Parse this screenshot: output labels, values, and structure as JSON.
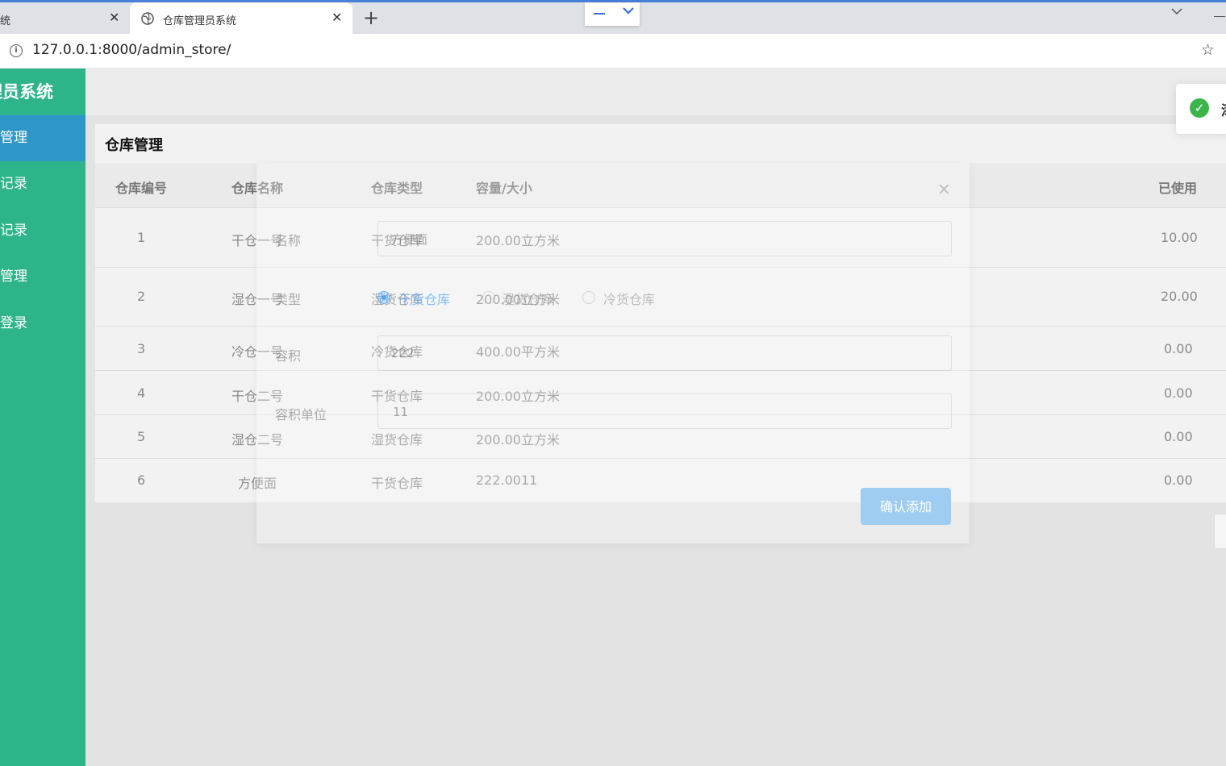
{
  "browser": {
    "tabs": [
      {
        "title": "统",
        "active": false
      },
      {
        "title": "仓库管理员系统",
        "active": true
      }
    ],
    "new_tab": "+",
    "close_glyph": "✕",
    "url": "127.0.0.1:8000/admin_store/",
    "icons": {
      "info": "i",
      "star": "☆",
      "globe": "globe-icon"
    }
  },
  "app": {
    "brand": "理员系统",
    "nav": [
      {
        "label": "库管理",
        "active": true
      },
      {
        "label": "入记录",
        "active": false
      },
      {
        "label": "出记录",
        "active": false
      },
      {
        "label": "户管理",
        "active": false
      },
      {
        "label": "出登录",
        "active": false
      }
    ],
    "accent_color": "#2db48a",
    "active_nav_color": "#2f97c8"
  },
  "card": {
    "title": "仓库管理",
    "headers": [
      "仓库编号",
      "仓库名称",
      "仓库类型",
      "容量/大小",
      "已使用"
    ],
    "rows": [
      {
        "id": "1",
        "name": "干仓一号",
        "type": "干货仓库",
        "capacity": "200.00立方米",
        "used": "10.00"
      },
      {
        "id": "2",
        "name": "湿仓一号",
        "type": "湿货仓库",
        "capacity": "200.00立方米",
        "used": "20.00"
      },
      {
        "id": "3",
        "name": "冷仓一号",
        "type": "冷货仓库",
        "capacity": "400.00平方米",
        "used": "0.00"
      },
      {
        "id": "4",
        "name": "干仓二号",
        "type": "干货仓库",
        "capacity": "200.00立方米",
        "used": "0.00"
      },
      {
        "id": "5",
        "name": "湿仓二号",
        "type": "湿货仓库",
        "capacity": "200.00立方米",
        "used": "0.00"
      },
      {
        "id": "6",
        "name": "方便面",
        "type": "干货仓库",
        "capacity": "222.0011",
        "used": "0.00"
      }
    ]
  },
  "modal": {
    "close": "×",
    "name_label": "名称",
    "name_value": "方便面",
    "type_label": "类型",
    "type_options": [
      {
        "label": "干货仓库",
        "selected": true
      },
      {
        "label": "湿货仓库",
        "selected": false
      },
      {
        "label": "冷货仓库",
        "selected": false
      }
    ],
    "volume_label": "容积",
    "volume_value": "222",
    "unit_label": "容积单位",
    "unit_value": "11",
    "submit": "确认添加"
  },
  "toast": {
    "icon": "✓",
    "text": "添"
  }
}
